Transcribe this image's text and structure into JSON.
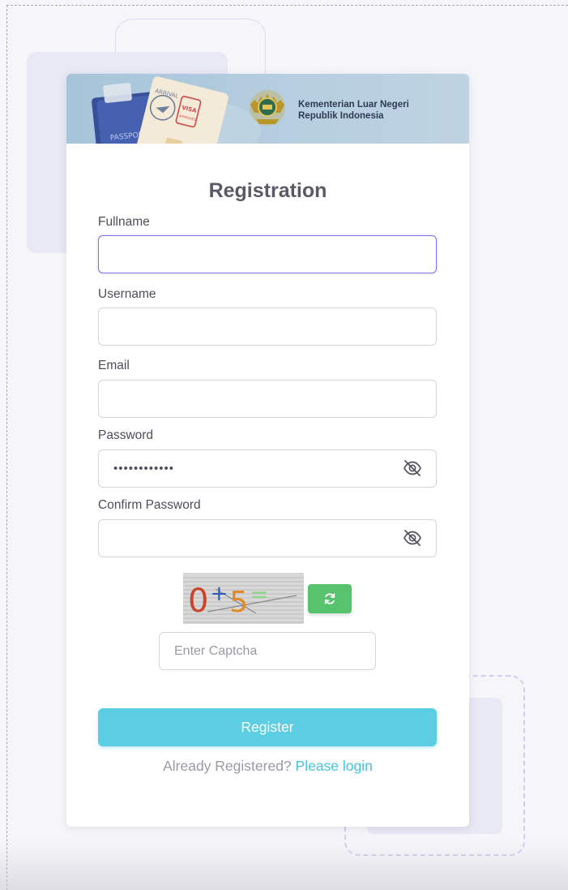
{
  "banner": {
    "passport_text": "PASSPORT",
    "stamp_arrival": "ARRIVAL",
    "stamp_visa": "VISA",
    "stamp_visa_sub": "APPROVED",
    "ministry_line1": "Kementerian Luar Negeri",
    "ministry_line2": "Republik Indonesia"
  },
  "form": {
    "title": "Registration",
    "fullname_label": "Fullname",
    "fullname_value": "",
    "username_label": "Username",
    "username_value": "",
    "email_label": "Email",
    "email_value": "",
    "password_label": "Password",
    "password_value": "••••••••••••",
    "confirm_password_label": "Confirm Password",
    "confirm_password_value": ""
  },
  "captcha": {
    "image_text": "0+5=",
    "input_placeholder": "Enter Captcha",
    "refresh_icon": "refresh-icon"
  },
  "actions": {
    "register_label": "Register",
    "already_registered_text": "Already Registered?",
    "login_link_text": "Please login"
  },
  "colors": {
    "accent": "#5ccde2",
    "focus_border": "#7c75e0",
    "refresh_button": "#58c36e",
    "link": "#47c4dc"
  },
  "icons": {
    "password_toggle": "eye-off-icon",
    "confirm_password_toggle": "eye-off-icon",
    "emblem": "garuda-emblem-icon"
  }
}
